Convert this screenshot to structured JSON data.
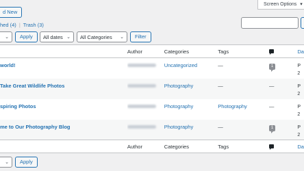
{
  "header": {
    "add_new": "d New",
    "screen_options": "Screen Options"
  },
  "subsubsub": {
    "published": "hed (4)",
    "separator": "|",
    "trash": "Trash (3)"
  },
  "toolbar_top": {
    "apply": "Apply",
    "dates": "All dates",
    "categories": "All Categories",
    "filter": "Filter"
  },
  "columns": {
    "author": "Author",
    "categories": "Categories",
    "tags": "Tags",
    "date": "Da"
  },
  "rows": [
    {
      "title": "world!",
      "category": "Uncategorized",
      "tags": "—",
      "comments": "1",
      "date": "P"
    },
    {
      "title": "Take Great Wildlife Photos",
      "category": "Photography",
      "tags": "—",
      "comments": "—",
      "date": "P"
    },
    {
      "title": "spiring Photos",
      "category": "Photography",
      "tags": "Photography",
      "comments": "—",
      "date": "P"
    },
    {
      "title": "me to Our Photography Blog",
      "category": "Photography",
      "tags": "—",
      "comments": "1",
      "date": "P"
    }
  ],
  "date_fragments": [
    "2",
    "2",
    "2",
    "2"
  ],
  "toolbar_bottom": {
    "apply": "Apply"
  },
  "colors": {
    "link": "#2271b1",
    "background": "#f0f0f1"
  }
}
